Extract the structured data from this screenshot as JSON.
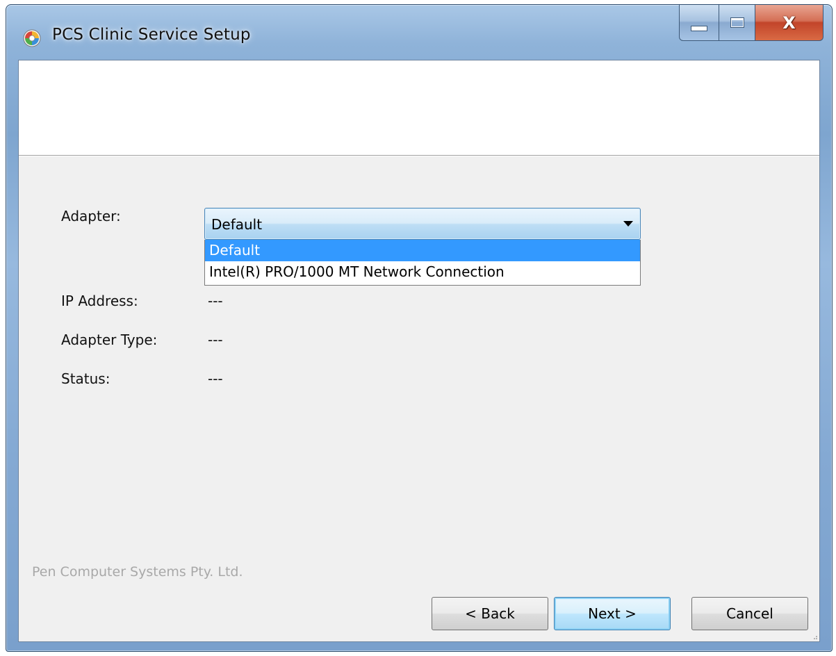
{
  "window": {
    "title": "PCS Clinic Service Setup",
    "controls": {
      "minimize_icon": "minimize-icon",
      "maximize_icon": "maximize-icon",
      "close_icon": "close-icon",
      "close_glyph": "X"
    }
  },
  "form": {
    "adapter_label": "Adapter:",
    "adapter_selected": "Default",
    "adapter_options": [
      "Default",
      "Intel(R) PRO/1000 MT Network Connection"
    ],
    "adapter_highlighted_index": 0,
    "ip_label": "IP Address:",
    "ip_value": "---",
    "type_label": "Adapter Type:",
    "type_value": "---",
    "status_label": "Status:",
    "status_value": "---"
  },
  "footer": {
    "vendor": "Pen Computer Systems Pty. Ltd.",
    "back_label": "< Back",
    "next_label": "Next >",
    "cancel_label": "Cancel"
  },
  "colors": {
    "highlight": "#3399ff",
    "client_bg": "#f0f0f0",
    "close_button": "#c2442a",
    "vendor_text": "#a8a8a8"
  }
}
